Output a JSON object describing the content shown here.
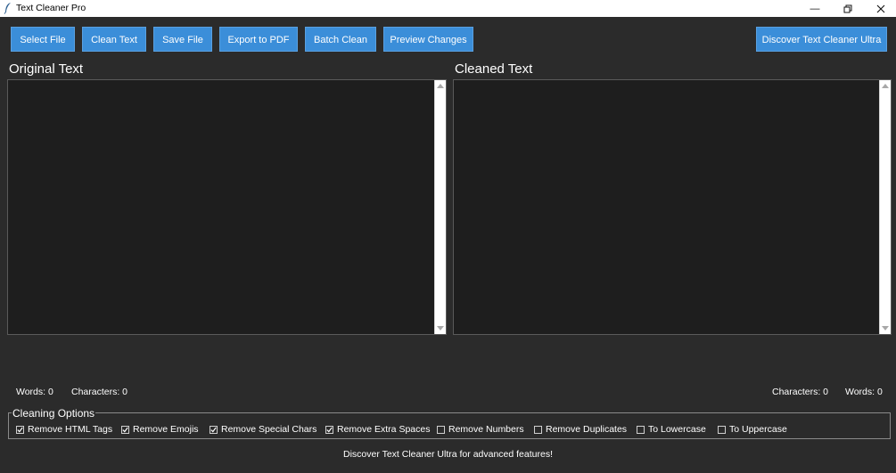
{
  "window": {
    "title": "Text Cleaner Pro"
  },
  "toolbar": {
    "select_file": "Select File",
    "clean_text": "Clean Text",
    "save_file": "Save File",
    "export_pdf": "Export to PDF",
    "batch_clean": "Batch Clean",
    "preview_changes": "Preview Changes",
    "discover_ultra": "Discover Text Cleaner Ultra"
  },
  "original": {
    "title": "Original Text",
    "content": "",
    "words_label": "Words: 0",
    "chars_label": "Characters: 0"
  },
  "cleaned": {
    "title": "Cleaned Text",
    "content": "",
    "chars_label": "Characters: 0",
    "words_label": "Words: 0"
  },
  "options": {
    "legend": "Cleaning Options",
    "items": [
      {
        "label": "Remove HTML Tags",
        "checked": true
      },
      {
        "label": "Remove Emojis",
        "checked": true
      },
      {
        "label": "Remove Special Chars",
        "checked": true
      },
      {
        "label": "Remove Extra Spaces",
        "checked": true
      },
      {
        "label": "Remove Numbers",
        "checked": false
      },
      {
        "label": "Remove Duplicates",
        "checked": false
      },
      {
        "label": "To Lowercase",
        "checked": false
      },
      {
        "label": "To Uppercase",
        "checked": false
      }
    ]
  },
  "footer": {
    "message": "Discover Text Cleaner Ultra for advanced features!"
  },
  "colors": {
    "accent": "#3b8ed9",
    "background": "#2b2b2b",
    "textbox": "#1e1e1e"
  }
}
